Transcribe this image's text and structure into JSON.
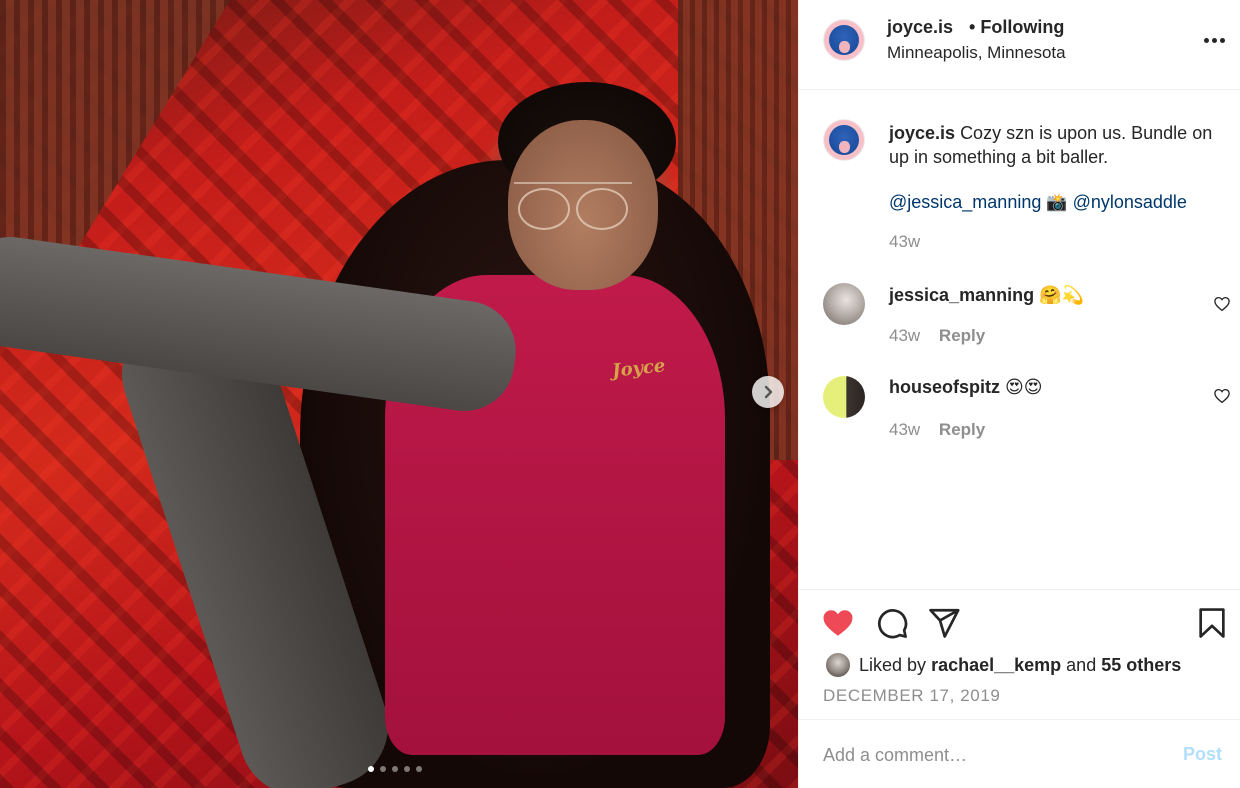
{
  "post": {
    "username": "joyce.is",
    "follow_status": "Following",
    "separator": "•",
    "location": "Minneapolis, Minnesota",
    "caption": "Cozy szn is upon us. Bundle on up in something a bit baller.",
    "mention_1": "@jessica_manning",
    "mention_emoji": "📸",
    "mention_2": "@nylonsaddle",
    "caption_time": "43w",
    "carousel": {
      "slides": 5,
      "active_index": 0
    },
    "image_print": "Joyce"
  },
  "comments": [
    {
      "username": "jessica_manning",
      "text": "🤗💫",
      "time": "43w",
      "reply_label": "Reply"
    },
    {
      "username": "houseofspitz",
      "text": "😍😍",
      "time": "43w",
      "reply_label": "Reply"
    }
  ],
  "likes": {
    "prefix": "Liked by",
    "first_user": "rachael__kemp",
    "joiner": "and",
    "others": "55 others"
  },
  "date": "DECEMBER 17, 2019",
  "composer": {
    "placeholder": "Add a comment…",
    "post_label": "Post"
  },
  "colors": {
    "like_red": "#ed4956",
    "link_blue": "#00376b",
    "post_disabled": "#b2dffc",
    "muted": "#8e8e8e"
  },
  "icons": [
    "more-icon",
    "heart-icon",
    "comment-icon",
    "share-icon",
    "save-icon",
    "chevron-right-icon"
  ]
}
